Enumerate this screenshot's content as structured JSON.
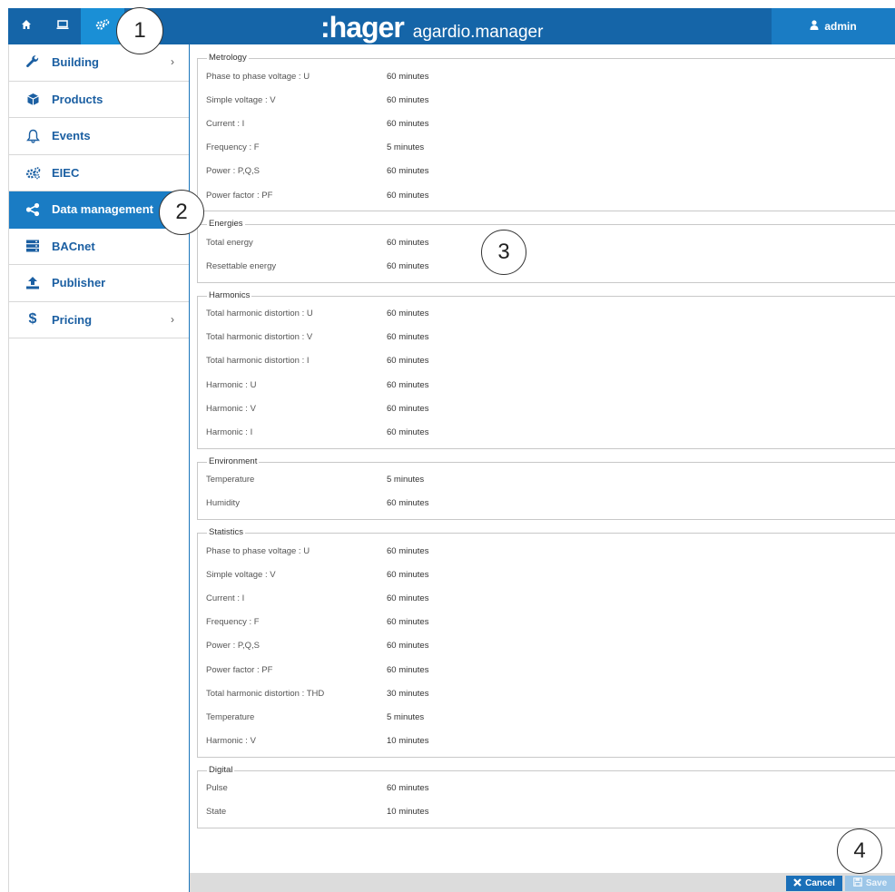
{
  "header": {
    "logo": ":hager",
    "product": "agardio.manager",
    "user": "admin",
    "nav_icons": [
      "home-icon",
      "monitor-icon",
      "gears-icon"
    ]
  },
  "sidebar": {
    "items": [
      {
        "label": "Building",
        "icon": "wrench-icon",
        "chevron": "›"
      },
      {
        "label": "Products",
        "icon": "cube-icon"
      },
      {
        "label": "Events",
        "icon": "bell-icon"
      },
      {
        "label": "EIEC",
        "icon": "gears-icon"
      },
      {
        "label": "Data management",
        "icon": "share-icon"
      },
      {
        "label": "BACnet",
        "icon": "server-icon"
      },
      {
        "label": "Publisher",
        "icon": "upload-icon"
      },
      {
        "label": "Pricing",
        "icon": "dollar-icon",
        "chevron": "›"
      }
    ]
  },
  "callouts": [
    "1",
    "2",
    "3",
    "4"
  ],
  "groups": [
    {
      "title": "Metrology",
      "rows": [
        {
          "label": "Phase to phase voltage : U",
          "value": "60 minutes"
        },
        {
          "label": "Simple voltage : V",
          "value": "60 minutes"
        },
        {
          "label": "Current : I",
          "value": "60 minutes"
        },
        {
          "label": "Frequency : F",
          "value": "5 minutes"
        },
        {
          "label": "Power : P,Q,S",
          "value": "60 minutes"
        },
        {
          "label": "Power factor : PF",
          "value": "60 minutes"
        }
      ]
    },
    {
      "title": "Energies",
      "rows": [
        {
          "label": "Total energy",
          "value": "60 minutes"
        },
        {
          "label": "Resettable energy",
          "value": "60 minutes"
        }
      ]
    },
    {
      "title": "Harmonics",
      "rows": [
        {
          "label": "Total harmonic distortion : U",
          "value": "60 minutes"
        },
        {
          "label": "Total harmonic distortion : V",
          "value": "60 minutes"
        },
        {
          "label": "Total harmonic distortion : I",
          "value": "60 minutes"
        },
        {
          "label": "Harmonic : U",
          "value": "60 minutes"
        },
        {
          "label": "Harmonic : V",
          "value": "60 minutes"
        },
        {
          "label": "Harmonic : I",
          "value": "60 minutes"
        }
      ]
    },
    {
      "title": "Environment",
      "rows": [
        {
          "label": "Temperature",
          "value": "5 minutes"
        },
        {
          "label": "Humidity",
          "value": "60 minutes"
        }
      ]
    },
    {
      "title": "Statistics",
      "rows": [
        {
          "label": "Phase to phase voltage : U",
          "value": "60 minutes"
        },
        {
          "label": "Simple voltage : V",
          "value": "60 minutes"
        },
        {
          "label": "Current : I",
          "value": "60 minutes"
        },
        {
          "label": "Frequency : F",
          "value": "60 minutes"
        },
        {
          "label": "Power : P,Q,S",
          "value": "60 minutes"
        },
        {
          "label": "Power factor : PF",
          "value": "60 minutes"
        },
        {
          "label": "Total harmonic distortion : THD",
          "value": "30 minutes"
        },
        {
          "label": "Temperature",
          "value": "5 minutes"
        },
        {
          "label": "Harmonic : V",
          "value": "10 minutes"
        }
      ]
    },
    {
      "title": "Digital",
      "rows": [
        {
          "label": "Pulse",
          "value": "60 minutes"
        },
        {
          "label": "State",
          "value": "10 minutes"
        }
      ]
    }
  ],
  "footer": {
    "cancel_label": "Cancel",
    "save_label": "Save"
  },
  "colors": {
    "primary": "#1565a8",
    "active": "#1a7cc4",
    "save_disabled": "#9cc6e8"
  }
}
